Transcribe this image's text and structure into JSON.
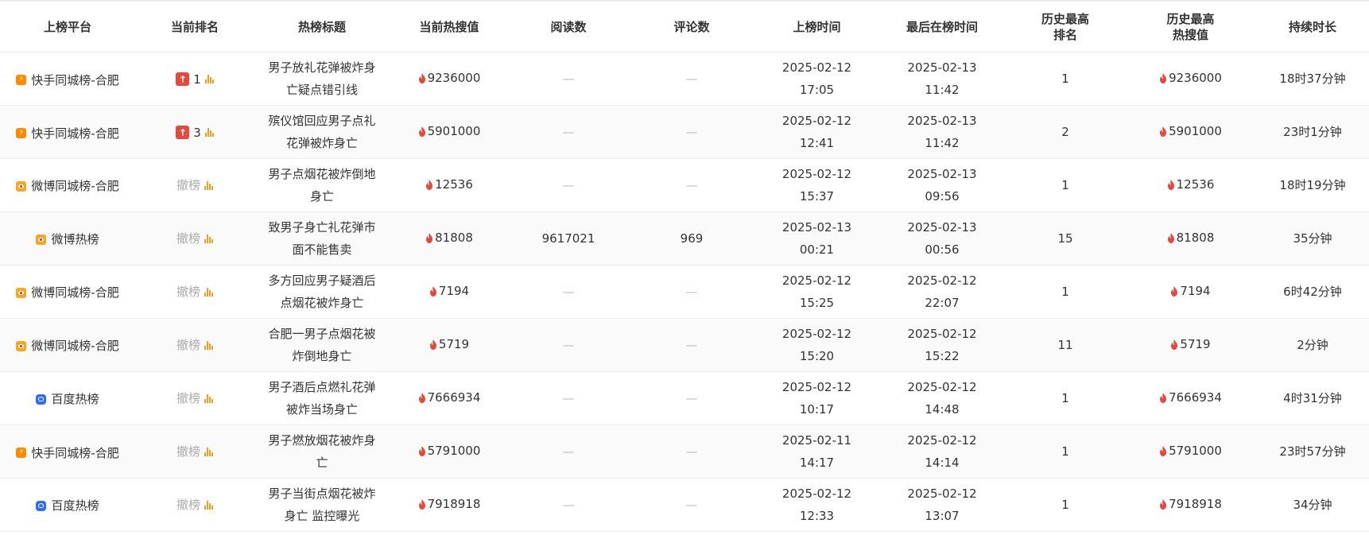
{
  "columns": [
    "上榜平台",
    "当前排名",
    "热榜标题",
    "当前热搜值",
    "阅读数",
    "评论数",
    "上榜时间",
    "最后在榜时间",
    "历史最高\n排名",
    "历史最高\n热搜值",
    "持续时长"
  ],
  "colors": {
    "flame": "#e8483b",
    "kuaishou": "#ff8a00",
    "weibo": "#f5a623",
    "baidu": "#2f6bff",
    "rank_up": "#e8483b",
    "bars": "#f0a020"
  },
  "rows": [
    {
      "platform": "快手同城榜-合肥",
      "platform_icon": "kuaishou-icon",
      "rank_status": "up",
      "rank": "1",
      "title": "男子放礼花弹被炸身亡疑点错引线",
      "hot": "9236000",
      "reads": "—",
      "comments": "—",
      "start_date": "2025-02-12",
      "start_time": "17:05",
      "last_date": "2025-02-13",
      "last_time": "11:42",
      "best_rank": "1",
      "best_hot": "9236000",
      "duration": "18时37分钟"
    },
    {
      "platform": "快手同城榜-合肥",
      "platform_icon": "kuaishou-icon",
      "rank_status": "up",
      "rank": "3",
      "title": "殡仪馆回应男子点礼花弹被炸身亡",
      "hot": "5901000",
      "reads": "—",
      "comments": "—",
      "start_date": "2025-02-12",
      "start_time": "12:41",
      "last_date": "2025-02-13",
      "last_time": "11:42",
      "best_rank": "2",
      "best_hot": "5901000",
      "duration": "23时1分钟"
    },
    {
      "platform": "微博同城榜-合肥",
      "platform_icon": "weibo-icon",
      "rank_status": "off",
      "rank": "撤榜",
      "title": "男子点烟花被炸倒地身亡",
      "hot": "12536",
      "reads": "—",
      "comments": "—",
      "start_date": "2025-02-12",
      "start_time": "15:37",
      "last_date": "2025-02-13",
      "last_time": "09:56",
      "best_rank": "1",
      "best_hot": "12536",
      "duration": "18时19分钟"
    },
    {
      "platform": "微博热榜",
      "platform_icon": "weibo-icon",
      "rank_status": "off",
      "rank": "撤榜",
      "title": "致男子身亡礼花弹市面不能售卖",
      "hot": "81808",
      "reads": "9617021",
      "comments": "969",
      "start_date": "2025-02-13",
      "start_time": "00:21",
      "last_date": "2025-02-13",
      "last_time": "00:56",
      "best_rank": "15",
      "best_hot": "81808",
      "duration": "35分钟"
    },
    {
      "platform": "微博同城榜-合肥",
      "platform_icon": "weibo-icon",
      "rank_status": "off",
      "rank": "撤榜",
      "title": "多方回应男子疑酒后点烟花被炸身亡",
      "hot": "7194",
      "reads": "—",
      "comments": "—",
      "start_date": "2025-02-12",
      "start_time": "15:25",
      "last_date": "2025-02-12",
      "last_time": "22:07",
      "best_rank": "1",
      "best_hot": "7194",
      "duration": "6时42分钟"
    },
    {
      "platform": "微博同城榜-合肥",
      "platform_icon": "weibo-icon",
      "rank_status": "off",
      "rank": "撤榜",
      "title": "合肥一男子点烟花被炸倒地身亡",
      "hot": "5719",
      "reads": "—",
      "comments": "—",
      "start_date": "2025-02-12",
      "start_time": "15:20",
      "last_date": "2025-02-12",
      "last_time": "15:22",
      "best_rank": "11",
      "best_hot": "5719",
      "duration": "2分钟"
    },
    {
      "platform": "百度热榜",
      "platform_icon": "baidu-icon",
      "rank_status": "off",
      "rank": "撤榜",
      "title": "男子酒后点燃礼花弹被炸当场身亡",
      "hot": "7666934",
      "reads": "—",
      "comments": "—",
      "start_date": "2025-02-12",
      "start_time": "10:17",
      "last_date": "2025-02-12",
      "last_time": "14:48",
      "best_rank": "1",
      "best_hot": "7666934",
      "duration": "4时31分钟"
    },
    {
      "platform": "快手同城榜-合肥",
      "platform_icon": "kuaishou-icon",
      "rank_status": "off",
      "rank": "撤榜",
      "title": "男子燃放烟花被炸身亡",
      "hot": "5791000",
      "reads": "—",
      "comments": "—",
      "start_date": "2025-02-11",
      "start_time": "14:17",
      "last_date": "2025-02-12",
      "last_time": "14:14",
      "best_rank": "1",
      "best_hot": "5791000",
      "duration": "23时57分钟"
    },
    {
      "platform": "百度热榜",
      "platform_icon": "baidu-icon",
      "rank_status": "off",
      "rank": "撤榜",
      "title": "男子当街点烟花被炸身亡 监控曝光",
      "hot": "7918918",
      "reads": "—",
      "comments": "—",
      "start_date": "2025-02-12",
      "start_time": "12:33",
      "last_date": "2025-02-12",
      "last_time": "13:07",
      "best_rank": "1",
      "best_hot": "7918918",
      "duration": "34分钟"
    }
  ]
}
